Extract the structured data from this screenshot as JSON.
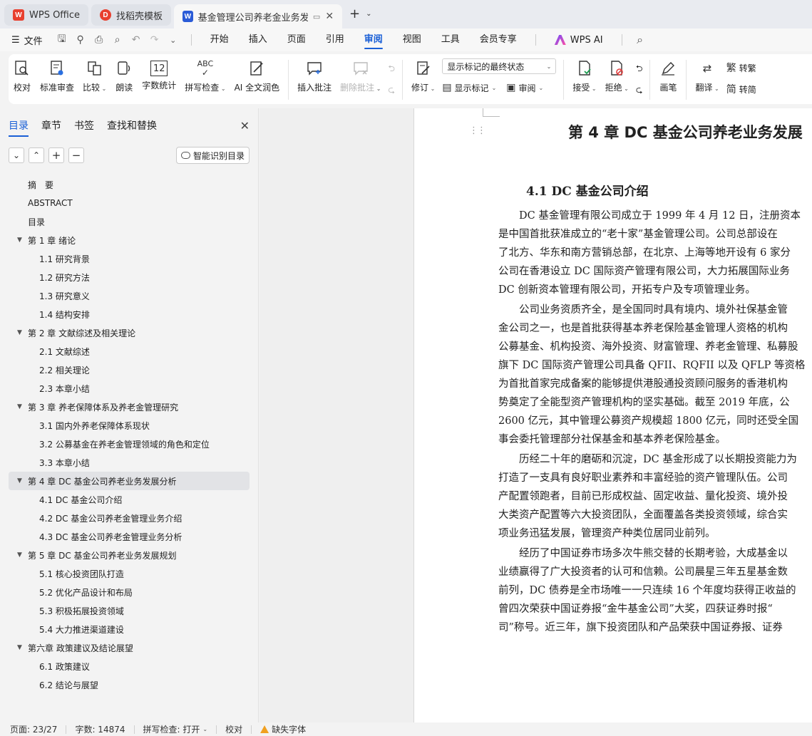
{
  "tabs": [
    {
      "label": "WPS Office",
      "logo": "W",
      "color": "#e8402f"
    },
    {
      "label": "找稻壳模板",
      "logo": "D",
      "color": "#e8402f"
    },
    {
      "label": "基金管理公司养老金业务发展",
      "logo": "W",
      "color": "#2a5bd7"
    }
  ],
  "menu": {
    "file_label": "文件",
    "items": [
      "开始",
      "插入",
      "页面",
      "引用",
      "审阅",
      "视图",
      "工具",
      "会员专享"
    ],
    "active": "审阅",
    "ai_label": "WPS AI"
  },
  "ribbon": {
    "proofread": "校对",
    "standard_review": "标准审查",
    "compare": "比较",
    "read_aloud": "朗读",
    "word_count": "字数统计",
    "word_count_icon_text": "12",
    "spell_check": "拼写检查",
    "spell_check_icon_text": "ABC",
    "ai_polish": "AI 全文润色",
    "insert_comment": "插入批注",
    "delete_comment": "删除批注",
    "revise": "修订",
    "markup_mode": "显示标记的最终状态",
    "show_markup": "显示标记",
    "review_pane": "审阅",
    "accept": "接受",
    "reject": "拒绝",
    "pen": "画笔",
    "translate": "翻译",
    "to_traditional": "转繁",
    "to_simplified": "转简"
  },
  "nav": {
    "tabs": [
      "目录",
      "章节",
      "书签",
      "查找和替换"
    ],
    "smart_toc": "智能识别目录",
    "toc": [
      {
        "level": 0,
        "text": "摘　要"
      },
      {
        "level": 0,
        "text": "ABSTRACT"
      },
      {
        "level": 0,
        "text": "目录"
      },
      {
        "level": 1,
        "text": "第 1 章  绪论"
      },
      {
        "level": 2,
        "text": "1.1  研究背景"
      },
      {
        "level": 2,
        "text": "1.2  研究方法"
      },
      {
        "level": 2,
        "text": "1.3  研究意义"
      },
      {
        "level": 2,
        "text": "1.4  结构安排"
      },
      {
        "level": 1,
        "text": "第 2 章  文献综述及相关理论"
      },
      {
        "level": 2,
        "text": "2.1 文献综述"
      },
      {
        "level": 2,
        "text": "2.2  相关理论"
      },
      {
        "level": 2,
        "text": "2.3  本章小结"
      },
      {
        "level": 1,
        "text": "第 3 章  养老保障体系及养老金管理研究"
      },
      {
        "level": 2,
        "text": "3.1  国内外养老保障体系现状"
      },
      {
        "level": 2,
        "text": "3.2  公募基金在养老金管理领域的角色和定位"
      },
      {
        "level": 2,
        "text": "3.3  本章小结"
      },
      {
        "level": 1,
        "text": "第 4 章  DC 基金公司养老业务发展分析",
        "selected": true
      },
      {
        "level": 2,
        "text": "4.1 DC 基金公司介绍"
      },
      {
        "level": 2,
        "text": "4.2 DC 基金公司养老金管理业务介绍"
      },
      {
        "level": 2,
        "text": "4.3 DC 基金公司养老金管理业务分析"
      },
      {
        "level": 1,
        "text": "第 5 章  DC 基金公司养老业务发展规划"
      },
      {
        "level": 2,
        "text": "5.1  核心投资团队打造"
      },
      {
        "level": 2,
        "text": "5.2  优化产品设计和布局"
      },
      {
        "level": 2,
        "text": "5.3  积极拓展投资领域"
      },
      {
        "level": 2,
        "text": "5.4  大力推进渠道建设"
      },
      {
        "level": 1,
        "text": "第六章  政策建议及结论展望"
      },
      {
        "level": 2,
        "text": "6.1  政策建议"
      },
      {
        "level": 2,
        "text": "6.2  结论与展望"
      }
    ]
  },
  "doc": {
    "chapter": "第 4 章  DC 基金公司养老业务发展",
    "section": "4.1 DC 基金公司介绍",
    "paragraphs": [
      [
        "　　DC 基金管理有限公司成立于 1999 年 4 月 12 日，注册资本",
        "是中国首批获准成立的“老十家”基金管理公司。公司总部设在",
        "了北方、华东和南方营销总部，在北京、上海等地开设有 6 家分",
        "公司在香港设立 DC 国际资产管理有限公司，大力拓展国际业务",
        "DC 创新资本管理有限公司，开拓专户及专项管理业务。"
      ],
      [
        "　　公司业务资质齐全，是全国同时具有境内、境外社保基金管",
        "金公司之一，也是首批获得基本养老保险基金管理人资格的机构",
        "公募基金、机构投资、海外投资、财富管理、养老金管理、私募股",
        "旗下 DC 国际资产管理公司具备 QFII、RQFII 以及 QFLP 等资格",
        "为首批首家完成备案的能够提供港股通投资顾问服务的香港机构",
        "势奠定了全能型资产管理机构的坚实基础。截至 2019 年底，公",
        "2600 亿元，其中管理公募资产规模超 1800 亿元，同时还受全国",
        "事会委托管理部分社保基金和基本养老保险基金。"
      ],
      [
        "　　历经二十年的磨砺和沉淀，DC 基金形成了以长期投资能力为",
        "打造了一支具有良好职业素养和丰富经验的资产管理队伍。公司",
        "产配置领跑者，目前已形成权益、固定收益、量化投资、境外投",
        "大类资产配置等六大投资团队，全面覆盖各类投资领域，综合实",
        "项业务迅猛发展，管理资产种类位居同业前列。"
      ],
      [
        "　　经历了中国证券市场多次牛熊交替的长期考验，大成基金以",
        "业绩赢得了广大投资者的认可和信赖。公司晨星三年五星基金数",
        "前列，DC 债券是全市场唯一一只连续 16 个年度均获得正收益的",
        "曾四次荣获中国证券报“金牛基金公司”大奖，四获证券时报“",
        "司”称号。近三年，旗下投资团队和产品荣获中国证券报、证券"
      ]
    ]
  },
  "status": {
    "page": "页面: 23/27",
    "word_count": "字数: 14874",
    "spell_check": "拼写检查: 打开",
    "proofread": "校对",
    "missing_font": "缺失字体"
  }
}
